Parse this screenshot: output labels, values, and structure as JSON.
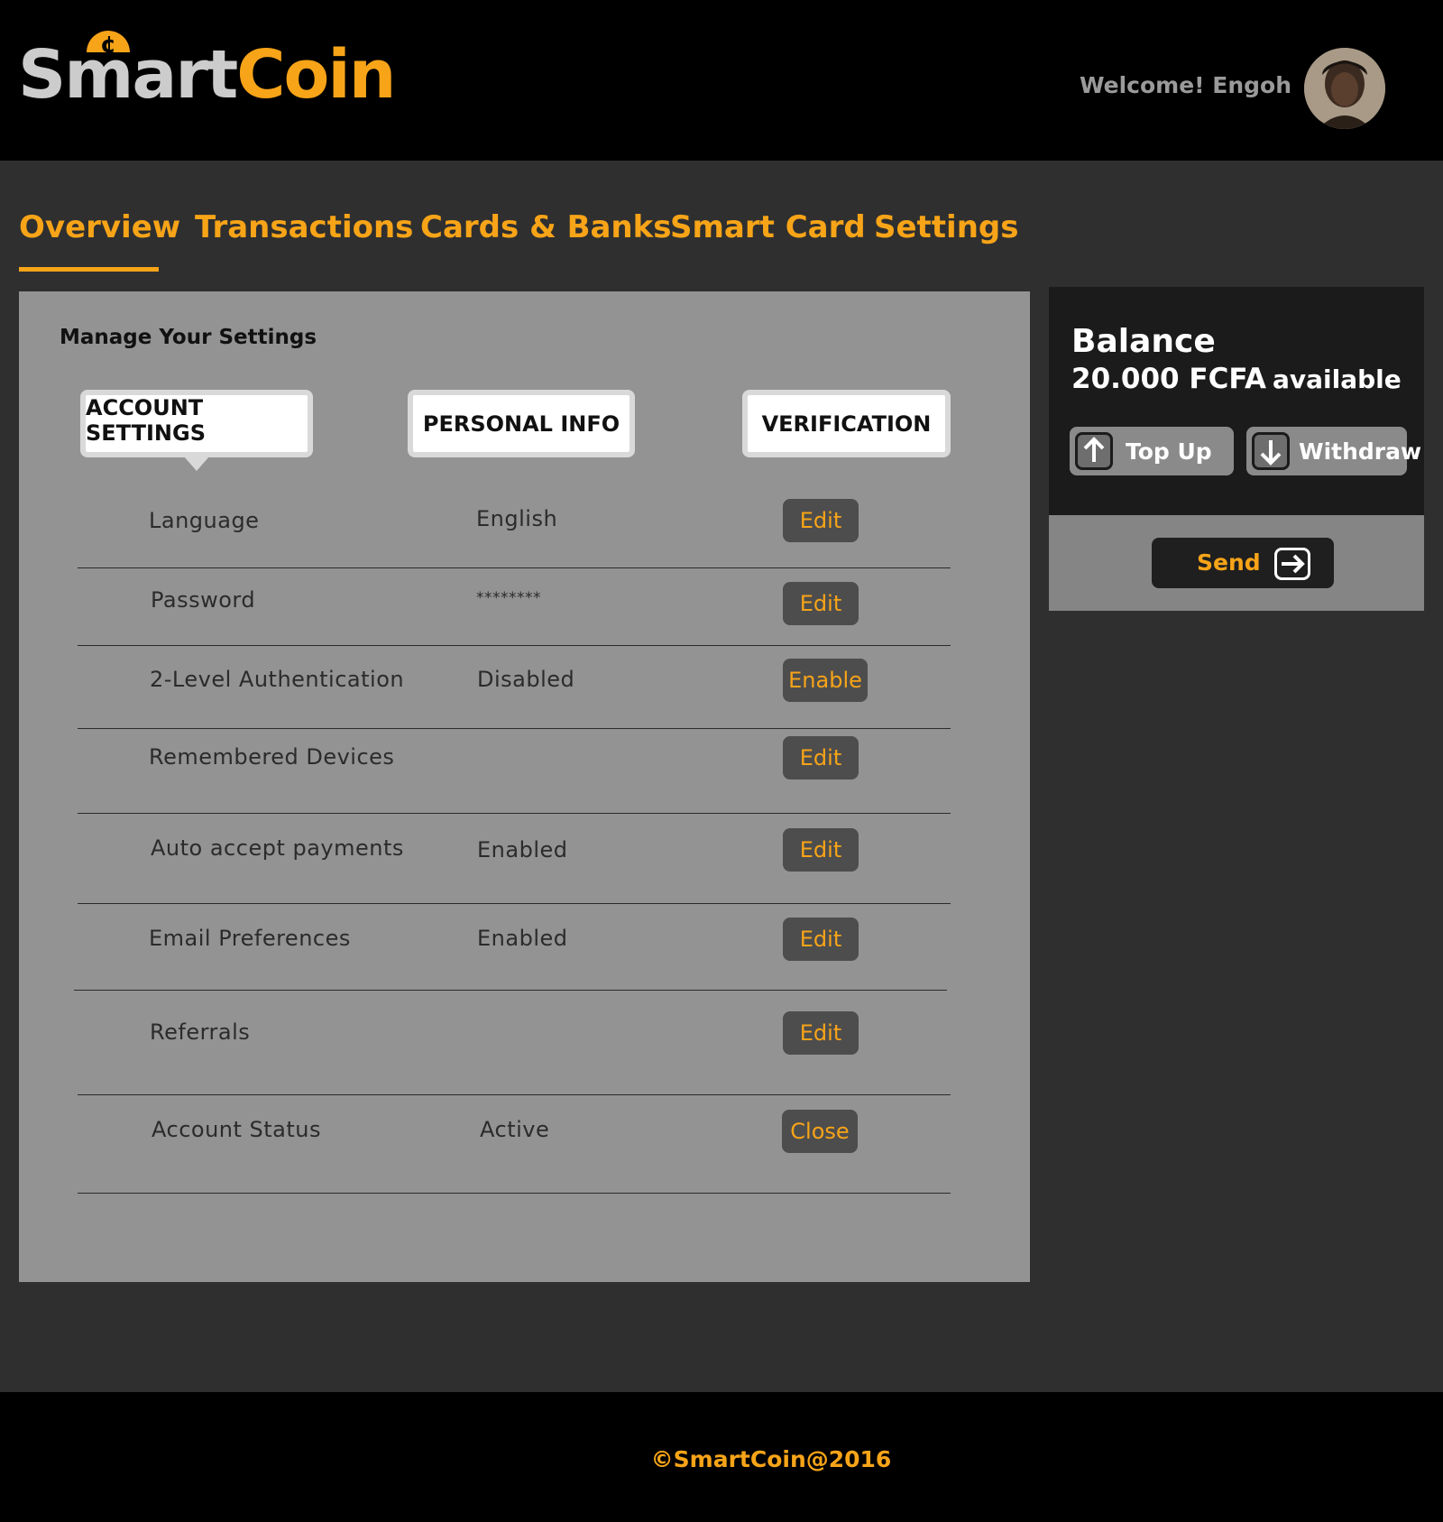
{
  "brand": {
    "name_part1": "Smart",
    "name_part2": "Coin",
    "accent_color": "#f7a418"
  },
  "header": {
    "welcome": "Welcome! Engoh",
    "avatar_icon": "user-avatar"
  },
  "nav": {
    "items": [
      {
        "label": "Overview",
        "active": true
      },
      {
        "label": "Transactions",
        "active": false
      },
      {
        "label": "Cards & Banks",
        "active": false
      },
      {
        "label": "Smart Card",
        "active": false
      },
      {
        "label": "Settings",
        "active": false
      }
    ]
  },
  "settings": {
    "title": "Manage Your Settings",
    "tabs": [
      {
        "label": "ACCOUNT SETTINGS",
        "active": true
      },
      {
        "label": "PERSONAL INFO",
        "active": false
      },
      {
        "label": "VERIFICATION",
        "active": false
      }
    ],
    "rows": [
      {
        "label": "Language",
        "value": "English",
        "action": "Edit"
      },
      {
        "label": "Password",
        "value": "********",
        "action": "Edit"
      },
      {
        "label": "2-Level Authentication",
        "value": "Disabled",
        "action": "Enable"
      },
      {
        "label": "Remembered Devices",
        "value": "",
        "action": "Edit"
      },
      {
        "label": "Auto accept payments",
        "value": "Enabled",
        "action": "Edit"
      },
      {
        "label": "Email Preferences",
        "value": "Enabled",
        "action": "Edit"
      },
      {
        "label": "Referrals",
        "value": "",
        "action": "Edit"
      },
      {
        "label": "Account Status",
        "value": "Active",
        "action": "Close"
      }
    ]
  },
  "balance": {
    "title": "Balance",
    "amount": "20.000 FCFA",
    "available_label": "available",
    "top_up_label": "Top Up",
    "withdraw_label": "Withdraw",
    "send_label": "Send"
  },
  "footer": {
    "text": "©SmartCoin@2016"
  }
}
